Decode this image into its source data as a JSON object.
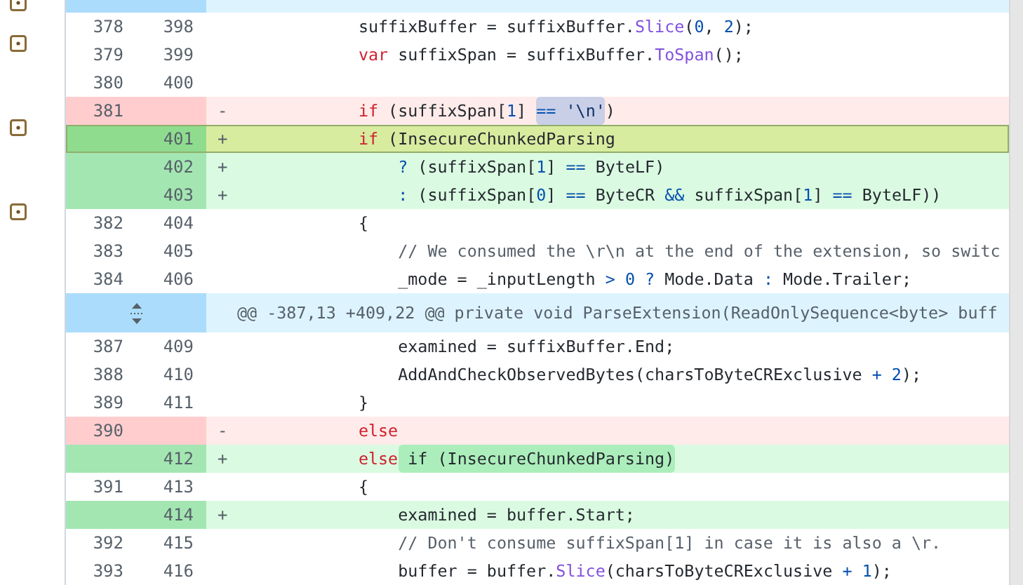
{
  "lines": [
    {
      "kind": "hunk",
      "selected": false,
      "marker": true
    },
    {
      "kind": "context",
      "old": "378",
      "new": "398",
      "selected": false,
      "marker": false,
      "code": [
        {
          "highlighted": false,
          "tokens": [
            {
              "text": "            suffixBuffer = suffixBuffer.",
              "kind": "plain"
            },
            {
              "text": "Slice",
              "kind": "method"
            },
            {
              "text": "(",
              "kind": "plain"
            },
            {
              "text": "0",
              "kind": "number"
            },
            {
              "text": ", ",
              "kind": "plain"
            },
            {
              "text": "2",
              "kind": "number"
            },
            {
              "text": ");",
              "kind": "plain"
            }
          ]
        }
      ]
    },
    {
      "kind": "context",
      "old": "379",
      "new": "399",
      "selected": false,
      "marker": true,
      "code": [
        {
          "highlighted": false,
          "tokens": [
            {
              "text": "            var",
              "kind": "keyword"
            },
            {
              "text": " suffixSpan = suffixBuffer.",
              "kind": "plain"
            },
            {
              "text": "ToSpan",
              "kind": "method"
            },
            {
              "text": "();",
              "kind": "plain"
            }
          ]
        }
      ]
    },
    {
      "kind": "context",
      "old": "380",
      "new": "400",
      "selected": false,
      "marker": false
    },
    {
      "kind": "removed",
      "old": "381",
      "sign": "-",
      "selected": false,
      "marker": false,
      "code": [
        {
          "highlighted": false,
          "tokens": [
            {
              "text": "            if",
              "kind": "keyword"
            },
            {
              "text": " (suffixSpan[",
              "kind": "plain"
            },
            {
              "text": "1",
              "kind": "number"
            },
            {
              "text": "] ",
              "kind": "plain"
            }
          ]
        },
        {
          "highlighted": true,
          "tokens": [
            {
              "text": "==",
              "kind": "operator"
            },
            {
              "text": " '\\n'",
              "kind": "string"
            }
          ]
        },
        {
          "highlighted": false,
          "tokens": [
            {
              "text": ")",
              "kind": "plain"
            }
          ]
        }
      ]
    },
    {
      "kind": "added",
      "new": "401",
      "sign": "+",
      "selected": true,
      "marker": true,
      "code": [
        {
          "highlighted": false,
          "tokens": [
            {
              "text": "            if",
              "kind": "keyword"
            },
            {
              "text": " (InsecureChunkedParsing",
              "kind": "plain"
            }
          ]
        }
      ]
    },
    {
      "kind": "added",
      "new": "402",
      "sign": "+",
      "selected": false,
      "marker": false,
      "code": [
        {
          "highlighted": false,
          "tokens": [
            {
              "text": "                ?",
              "kind": "operator"
            },
            {
              "text": " (suffixSpan[",
              "kind": "plain"
            },
            {
              "text": "1",
              "kind": "number"
            },
            {
              "text": "] ",
              "kind": "plain"
            },
            {
              "text": "==",
              "kind": "operator"
            },
            {
              "text": " ByteLF)",
              "kind": "plain"
            }
          ]
        }
      ]
    },
    {
      "kind": "added",
      "new": "403",
      "sign": "+",
      "selected": false,
      "marker": false,
      "code": [
        {
          "highlighted": false,
          "tokens": [
            {
              "text": "                :",
              "kind": "operator"
            },
            {
              "text": " (suffixSpan[",
              "kind": "plain"
            },
            {
              "text": "0",
              "kind": "number"
            },
            {
              "text": "] ",
              "kind": "plain"
            },
            {
              "text": "==",
              "kind": "operator"
            },
            {
              "text": " ByteCR ",
              "kind": "plain"
            },
            {
              "text": "&&",
              "kind": "operator"
            },
            {
              "text": " suffixSpan[",
              "kind": "plain"
            },
            {
              "text": "1",
              "kind": "number"
            },
            {
              "text": "] ",
              "kind": "plain"
            },
            {
              "text": "==",
              "kind": "operator"
            },
            {
              "text": " ByteLF))",
              "kind": "plain"
            }
          ]
        }
      ]
    },
    {
      "kind": "context",
      "old": "382",
      "new": "404",
      "selected": false,
      "marker": true,
      "code": [
        {
          "highlighted": false,
          "tokens": [
            {
              "text": "            {",
              "kind": "plain"
            }
          ]
        }
      ]
    },
    {
      "kind": "context",
      "old": "383",
      "new": "405",
      "selected": false,
      "marker": false,
      "code": [
        {
          "highlighted": false,
          "tokens": [
            {
              "text": "                // We consumed the \\r\\n at the end of the extension, so switc",
              "kind": "comment"
            }
          ]
        }
      ]
    },
    {
      "kind": "context",
      "old": "384",
      "new": "406",
      "selected": false,
      "marker": false,
      "code": [
        {
          "highlighted": false,
          "tokens": [
            {
              "text": "                _mode = _inputLength ",
              "kind": "plain"
            },
            {
              "text": ">",
              "kind": "operator"
            },
            {
              "text": " 0",
              "kind": "number"
            },
            {
              "text": " ?",
              "kind": "operator"
            },
            {
              "text": " Mode.Data ",
              "kind": "plain"
            },
            {
              "text": ":",
              "kind": "operator"
            },
            {
              "text": " Mode.Trailer;",
              "kind": "plain"
            }
          ]
        }
      ]
    },
    {
      "kind": "hunk",
      "text": "@@ -387,13 +409,22 @@ private void ParseExtension(ReadOnlySequence<byte> buff",
      "selected": false,
      "marker": false
    },
    {
      "kind": "context",
      "old": "387",
      "new": "409",
      "selected": false,
      "marker": false,
      "code": [
        {
          "highlighted": false,
          "tokens": [
            {
              "text": "                examined = suffixBuffer.End;",
              "kind": "plain"
            }
          ]
        }
      ]
    },
    {
      "kind": "context",
      "old": "388",
      "new": "410",
      "selected": false,
      "marker": false,
      "code": [
        {
          "highlighted": false,
          "tokens": [
            {
              "text": "                AddAndCheckObservedBytes(charsToByteCRExclusive ",
              "kind": "plain"
            },
            {
              "text": "+",
              "kind": "operator"
            },
            {
              "text": " 2",
              "kind": "number"
            },
            {
              "text": ");",
              "kind": "plain"
            }
          ]
        }
      ]
    },
    {
      "kind": "context",
      "old": "389",
      "new": "411",
      "selected": false,
      "marker": false,
      "code": [
        {
          "highlighted": false,
          "tokens": [
            {
              "text": "            }",
              "kind": "plain"
            }
          ]
        }
      ]
    },
    {
      "kind": "removed",
      "old": "390",
      "sign": "-",
      "selected": false,
      "marker": false,
      "code": [
        {
          "highlighted": false,
          "tokens": [
            {
              "text": "            else",
              "kind": "keyword"
            }
          ]
        }
      ]
    },
    {
      "kind": "added",
      "new": "412",
      "sign": "+",
      "selected": false,
      "marker": false,
      "code": [
        {
          "highlighted": false,
          "tokens": [
            {
              "text": "            else",
              "kind": "keyword"
            }
          ]
        },
        {
          "highlighted": true,
          "tokens": [
            {
              "text": " if (InsecureChunkedParsing)",
              "kind": "plain"
            }
          ]
        }
      ]
    },
    {
      "kind": "context",
      "old": "391",
      "new": "413",
      "selected": false,
      "marker": false,
      "code": [
        {
          "highlighted": false,
          "tokens": [
            {
              "text": "            {",
              "kind": "plain"
            }
          ]
        }
      ]
    },
    {
      "kind": "added",
      "new": "414",
      "sign": "+",
      "selected": false,
      "marker": false,
      "code": [
        {
          "highlighted": false,
          "tokens": [
            {
              "text": "                examined = buffer.Start;",
              "kind": "plain"
            }
          ]
        }
      ]
    },
    {
      "kind": "context",
      "old": "392",
      "new": "415",
      "selected": false,
      "marker": false,
      "code": [
        {
          "highlighted": false,
          "tokens": [
            {
              "text": "                // Don't consume suffixSpan[1] in case it is also a \\r.",
              "kind": "comment"
            }
          ]
        }
      ]
    },
    {
      "kind": "context",
      "old": "393",
      "new": "416",
      "selected": false,
      "marker": false,
      "code": [
        {
          "highlighted": false,
          "tokens": [
            {
              "text": "                buffer = buffer.",
              "kind": "plain"
            },
            {
              "text": "Slice",
              "kind": "method"
            },
            {
              "text": "(charsToByteCRExclusive ",
              "kind": "plain"
            },
            {
              "text": "+",
              "kind": "operator"
            },
            {
              "text": " 1",
              "kind": "number"
            },
            {
              "text": ");",
              "kind": "plain"
            }
          ]
        }
      ]
    }
  ]
}
